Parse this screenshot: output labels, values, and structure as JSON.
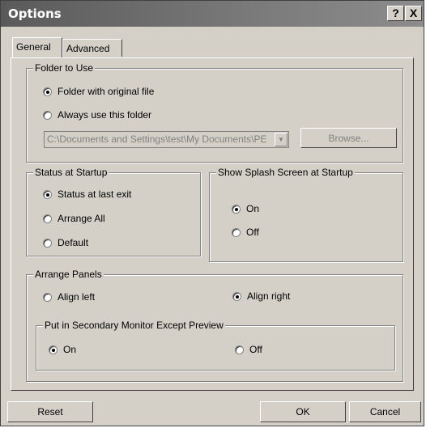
{
  "window": {
    "title": "Options",
    "help_button": "?",
    "close_button": "X"
  },
  "tabs": [
    {
      "label": "General",
      "selected": true
    },
    {
      "label": "Advanced",
      "selected": false
    }
  ],
  "folder_group": {
    "title": "Folder to Use",
    "options": [
      {
        "label": "Folder with original file",
        "selected": true
      },
      {
        "label": "Always use this folder",
        "selected": false
      }
    ],
    "path_value": "C:\\Documents and Settings\\test\\My Documents\\PE",
    "browse_label": "Browse..."
  },
  "status_group": {
    "title": "Status at Startup",
    "options": [
      {
        "label": "Status at last exit",
        "selected": true
      },
      {
        "label": "Arrange All",
        "selected": false
      },
      {
        "label": "Default",
        "selected": false
      }
    ]
  },
  "splash_group": {
    "title": "Show Splash Screen at Startup",
    "options": [
      {
        "label": "On",
        "selected": true
      },
      {
        "label": "Off",
        "selected": false
      }
    ]
  },
  "arrange_group": {
    "title": "Arrange Panels",
    "options": [
      {
        "label": "Align left",
        "selected": false
      },
      {
        "label": "Align right",
        "selected": true
      }
    ],
    "secondary": {
      "title": "Put in Secondary Monitor Except Preview",
      "options": [
        {
          "label": "On",
          "selected": true
        },
        {
          "label": "Off",
          "selected": false
        }
      ]
    }
  },
  "buttons": {
    "reset": "Reset",
    "ok": "OK",
    "cancel": "Cancel"
  }
}
